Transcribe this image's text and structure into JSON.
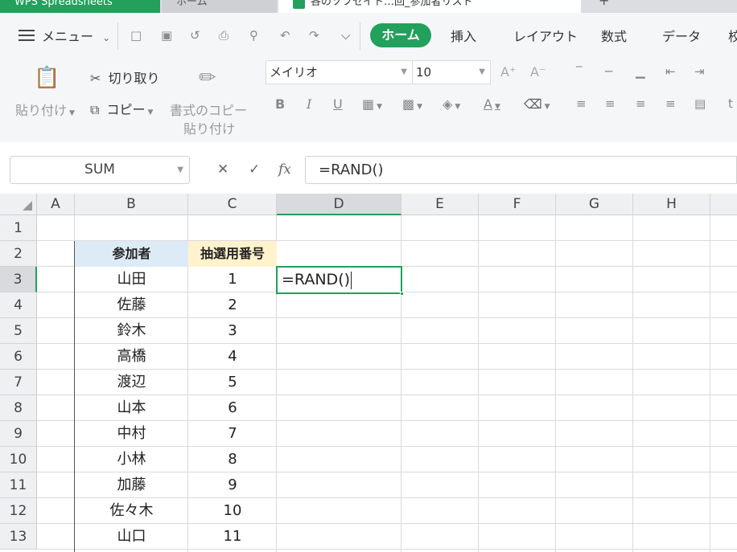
{
  "colors": {
    "accent": "#22a05c",
    "header_b_fill": "#ddebf7",
    "header_c_fill": "#fff2cc"
  },
  "tabs": {
    "app": "WPS Spreadsheets",
    "home": "ホーム",
    "document": "各のソフセイト…回_参加者リスト"
  },
  "menu": {
    "menu_label": "メニュー",
    "items": [
      "ホーム",
      "挿入",
      "レイアウト",
      "数式",
      "データ",
      "校"
    ]
  },
  "ribbon": {
    "paste": "貼り付け",
    "cut": "切り取り",
    "copy": "コピー",
    "format_painter_line1": "書式のコピー",
    "format_painter_line2": "貼り付け",
    "font_name": "メイリオ",
    "font_size": "10",
    "bold": "B",
    "italic": "I",
    "underline": "U"
  },
  "formula_bar": {
    "name_box": "SUM",
    "formula": "=RAND()"
  },
  "grid": {
    "columns": [
      "A",
      "B",
      "C",
      "D",
      "E",
      "F",
      "G",
      "H"
    ],
    "rows": [
      "1",
      "2",
      "3",
      "4",
      "5",
      "6",
      "7",
      "8",
      "9",
      "10",
      "11",
      "12",
      "13"
    ],
    "selected_column": "D",
    "selected_row": "3",
    "header_participant": "参加者",
    "header_number": "抽選用番号",
    "participants": [
      "山田",
      "佐藤",
      "鈴木",
      "高橋",
      "渡辺",
      "山本",
      "中村",
      "小林",
      "加藤",
      "佐々木",
      "山口"
    ],
    "numbers": [
      "1",
      "2",
      "3",
      "4",
      "5",
      "6",
      "7",
      "8",
      "9",
      "10",
      "11"
    ],
    "active_cell_text": "=RAND()"
  }
}
